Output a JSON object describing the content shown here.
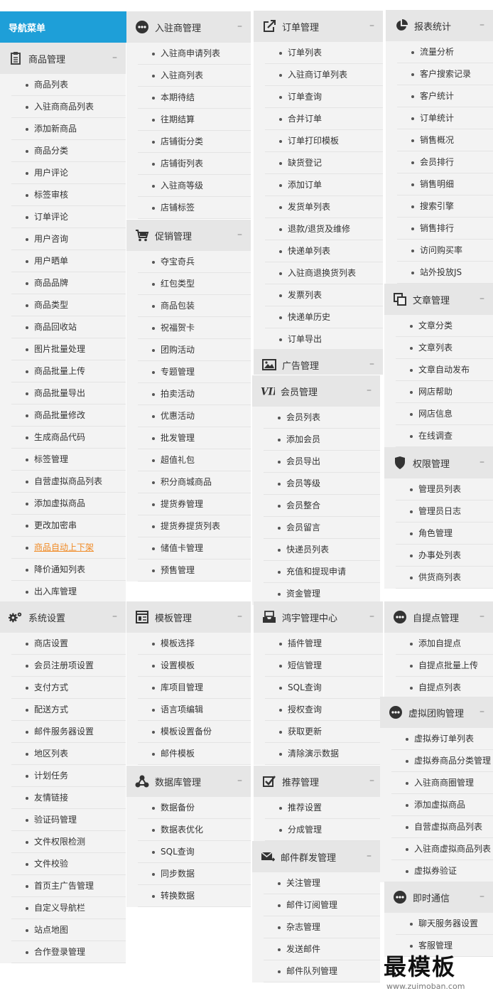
{
  "nav_title": "导航菜单",
  "colors": {
    "accent": "#1e9fd8",
    "highlight": "#f08a24"
  },
  "panels": [
    {
      "title": "商品管理",
      "icon": "clipboard-icon",
      "items": [
        "商品列表",
        "入驻商商品列表",
        "添加新商品",
        "商品分类",
        "用户评论",
        "标签审核",
        "订单评论",
        "用户咨询",
        "用户晒单",
        "商品品牌",
        "商品类型",
        "商品回收站",
        "图片批量处理",
        "商品批量上传",
        "商品批量导出",
        "商品批量修改",
        "生成商品代码",
        "标签管理",
        "自营虚拟商品列表",
        "添加虚拟商品",
        "更改加密串",
        "商品自动上下架",
        "降价通知列表",
        "出入库管理"
      ],
      "highlight": 21
    },
    {
      "title": "入驻商管理",
      "icon": "more-icon",
      "items": [
        "入驻商申请列表",
        "入驻商列表",
        "本期待结",
        "往期结算",
        "店铺街分类",
        "店铺街列表",
        "入驻商等级",
        "店铺标签"
      ]
    },
    {
      "title": "促销管理",
      "icon": "cart-icon",
      "items": [
        "夺宝奇兵",
        "红包类型",
        "商品包装",
        "祝福贺卡",
        "团购活动",
        "专题管理",
        "拍卖活动",
        "优惠活动",
        "批发管理",
        "超值礼包",
        "积分商城商品",
        "提货券管理",
        "提货券提货列表",
        "储值卡管理",
        "预售管理"
      ]
    },
    {
      "title": "订单管理",
      "icon": "edit-icon",
      "items": [
        "订单列表",
        "入驻商订单列表",
        "订单查询",
        "合并订单",
        "订单打印模板",
        "缺货登记",
        "添加订单",
        "发货单列表",
        "退款/退货及维修",
        "快递单列表",
        "入驻商退换货列表",
        "发票列表",
        "快递单历史",
        "订单导出"
      ]
    },
    {
      "title": "广告管理",
      "icon": "image-icon",
      "items": []
    },
    {
      "title": "会员管理",
      "icon": "vip-icon",
      "items": [
        "会员列表",
        "添加会员",
        "会员导出",
        "会员等级",
        "会员整合",
        "会员留言",
        "快递员列表",
        "充值和提现申请",
        "资金管理"
      ]
    },
    {
      "title": "报表统计",
      "icon": "pie-chart-icon",
      "items": [
        "流量分析",
        "客户搜索记录",
        "客户统计",
        "订单统计",
        "销售概况",
        "会员排行",
        "销售明细",
        "搜索引擎",
        "销售排行",
        "访问购买率",
        "站外投放JS"
      ]
    },
    {
      "title": "文章管理",
      "icon": "copy-icon",
      "items": [
        "文章分类",
        "文章列表",
        "文章自动发布",
        "网店帮助",
        "网店信息",
        "在线调查"
      ]
    },
    {
      "title": "权限管理",
      "icon": "shield-icon",
      "items": [
        "管理员列表",
        "管理员日志",
        "角色管理",
        "办事处列表",
        "供货商列表"
      ]
    },
    {
      "title": "系统设置",
      "icon": "gears-icon",
      "items": [
        "商店设置",
        "会员注册项设置",
        "支付方式",
        "配送方式",
        "邮件服务器设置",
        "地区列表",
        "计划任务",
        "友情链接",
        "验证码管理",
        "文件权限检测",
        "文件校验",
        "首页主广告管理",
        "自定义导航栏",
        "站点地图",
        "合作登录管理"
      ]
    },
    {
      "title": "模板管理",
      "icon": "template-icon",
      "items": [
        "模板选择",
        "设置模板",
        "库项目管理",
        "语言项编辑",
        "模板设置备份",
        "邮件模板"
      ]
    },
    {
      "title": "数据库管理",
      "icon": "share-nodes-icon",
      "items": [
        "数据备份",
        "数据表优化",
        "SQL查询",
        "同步数据",
        "转换数据"
      ]
    },
    {
      "title": "鸿宇管理中心",
      "icon": "inbox-icon",
      "items": [
        "插件管理",
        "短信管理",
        "SQL查询",
        "授权查询",
        "获取更新",
        "清除演示数据"
      ]
    },
    {
      "title": "推荐管理",
      "icon": "checkbox-icon",
      "items": [
        "推荐设置",
        "分成管理"
      ]
    },
    {
      "title": "邮件群发管理",
      "icon": "mail-icon",
      "items": [
        "关注管理",
        "邮件订阅管理",
        "杂志管理",
        "发送邮件",
        "邮件队列管理"
      ]
    },
    {
      "title": "自提点管理",
      "icon": "more-icon",
      "items": [
        "添加自提点",
        "自提点批量上传",
        "自提点列表"
      ]
    },
    {
      "title": "虚拟团购管理",
      "icon": "more-icon",
      "items": [
        "虚拟券订单列表",
        "虚拟券商品分类管理",
        "入驻商商圈管理",
        "添加虚拟商品",
        "自营虚拟商品列表",
        "入驻商虚拟商品列表",
        "虚拟券验证"
      ]
    },
    {
      "title": "即时通信",
      "icon": "more-icon",
      "items": [
        "聊天服务器设置",
        "客服管理"
      ]
    }
  ],
  "watermark": {
    "logo_text": "最模板",
    "url_text": "www.zuimoban.com"
  }
}
